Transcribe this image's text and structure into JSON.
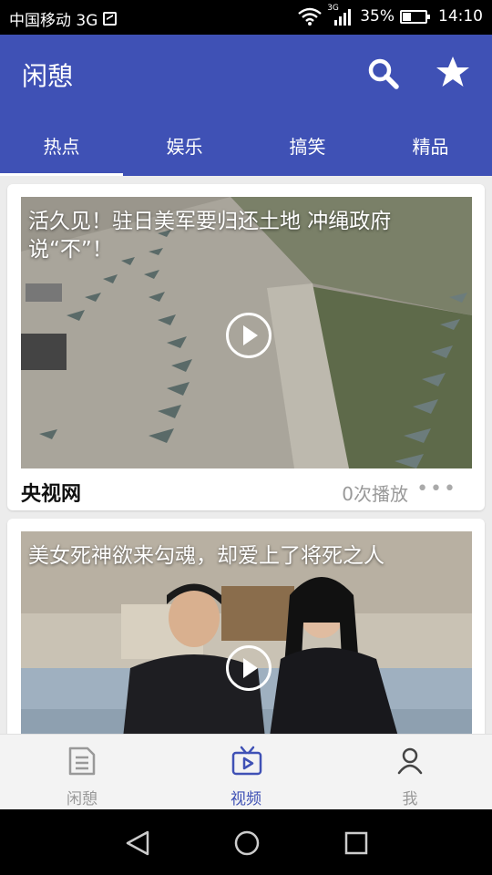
{
  "status_bar": {
    "carrier": "中国移动 3G",
    "network_tag": "3G",
    "battery": "35%",
    "time": "14:10",
    "icons": [
      "image-icon",
      "wifi-icon",
      "signal-icon",
      "battery-icon"
    ]
  },
  "header": {
    "title": "闲憩",
    "actions": [
      "search-icon",
      "star-icon"
    ],
    "accent_color": "#3f51b5"
  },
  "tabs": [
    {
      "label": "热点",
      "active": true
    },
    {
      "label": "娱乐",
      "active": false
    },
    {
      "label": "搞笑",
      "active": false
    },
    {
      "label": "精品",
      "active": false
    }
  ],
  "feed": {
    "items": [
      {
        "title": "活久见！驻日美军要归还土地 冲绳政府说“不”！",
        "source": "央视网",
        "plays": "0次播放"
      },
      {
        "title": "美女死神欲来勾魂，却爱上了将死之人"
      }
    ]
  },
  "bottom_nav": {
    "items": [
      {
        "label": "闲憩",
        "icon": "article-icon",
        "active": false
      },
      {
        "label": "视频",
        "icon": "tv-play-icon",
        "active": true
      },
      {
        "label": "我",
        "icon": "person-icon",
        "active": false
      }
    ]
  },
  "system_nav": [
    "back-icon",
    "home-icon",
    "recents-icon"
  ]
}
